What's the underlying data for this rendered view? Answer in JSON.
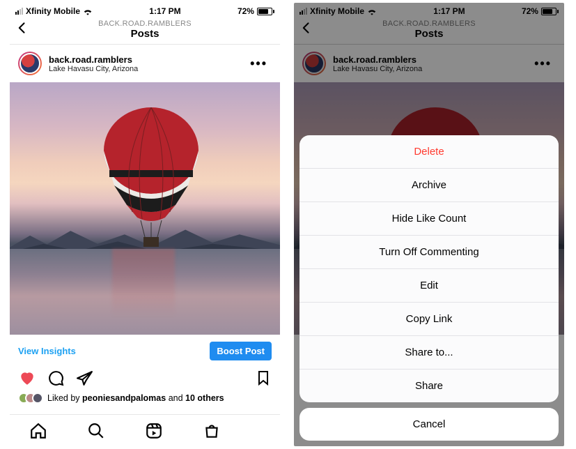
{
  "status": {
    "carrier": "Xfinity Mobile",
    "time": "1:17 PM",
    "battery_pct": "72%"
  },
  "header": {
    "breadcrumb": "BACK.ROAD.RAMBLERS",
    "title": "Posts"
  },
  "post": {
    "username": "back.road.ramblers",
    "location": "Lake Havasu City, Arizona",
    "view_insights": "View Insights",
    "boost": "Boost Post",
    "likes_prefix": "Liked by ",
    "likes_user": "peoniesandpalomas",
    "likes_and": " and ",
    "likes_others": "10 others"
  },
  "action_sheet": {
    "items": [
      "Delete",
      "Archive",
      "Hide Like Count",
      "Turn Off Commenting",
      "Edit",
      "Copy Link",
      "Share to...",
      "Share"
    ],
    "cancel": "Cancel"
  }
}
